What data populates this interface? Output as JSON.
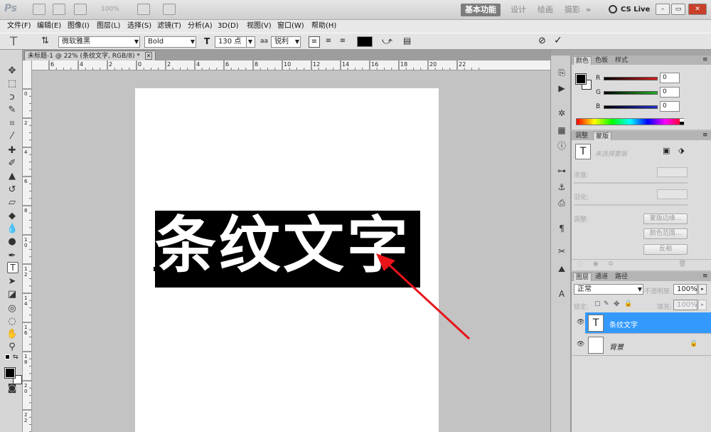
{
  "appbar": {
    "logo": "Ps",
    "zoom": "100%",
    "workspaces": [
      "基本功能",
      "设计",
      "绘画",
      "摄影"
    ],
    "more": "»",
    "cslive": "CS Live"
  },
  "menu": [
    "文件(F)",
    "编辑(E)",
    "图像(I)",
    "图层(L)",
    "选择(S)",
    "滤镜(T)",
    "分析(A)",
    "3D(D)",
    "视图(V)",
    "窗口(W)",
    "帮助(H)"
  ],
  "options": {
    "font_family": "微软雅黑",
    "font_style": "Bold",
    "font_size": "130 点",
    "aa_label": "aa",
    "antialias": "锐利",
    "color": "#000000"
  },
  "document": {
    "tab_title": "未标题-1 @ 22% (条纹文字, RGB/8) *",
    "text": "条纹文字",
    "arrow_color": "#e8141a"
  },
  "rulers": {
    "top": [
      "6",
      "4",
      "2",
      "0",
      "2",
      "4",
      "6",
      "8",
      "10",
      "12",
      "14",
      "16",
      "18",
      "20",
      "22"
    ],
    "left": [
      "0",
      "2",
      "4",
      "6",
      "8",
      "1 0",
      "1 2",
      "1 4",
      "1 6",
      "1 8",
      "2 0",
      "2 2"
    ]
  },
  "color_panel": {
    "tabs": [
      "颜色",
      "色板",
      "样式"
    ],
    "channels": [
      {
        "label": "R",
        "value": "0",
        "color": "#d92020"
      },
      {
        "label": "G",
        "value": "0",
        "color": "#20b020"
      },
      {
        "label": "B",
        "value": "0",
        "color": "#2030d0"
      }
    ]
  },
  "adjust_panel": {
    "tabs": [
      "调整",
      "蒙版"
    ],
    "no_selection": "未选择蒙版",
    "density": "浓度:",
    "feather": "羽化:",
    "refine": "调整:",
    "buttons": [
      "蒙版边缘...",
      "颜色范围...",
      "反相"
    ]
  },
  "layers_panel": {
    "tabs": [
      "图层",
      "通道",
      "路径"
    ],
    "blend": "正常",
    "opacity_label": "不透明度:",
    "opacity": "100%",
    "lock_label": "锁定:",
    "fill_label": "填充:",
    "fill": "100%",
    "layers": [
      {
        "name": "条纹文字",
        "type": "text",
        "selected": true
      },
      {
        "name": "背景",
        "type": "background",
        "selected": false
      }
    ]
  }
}
